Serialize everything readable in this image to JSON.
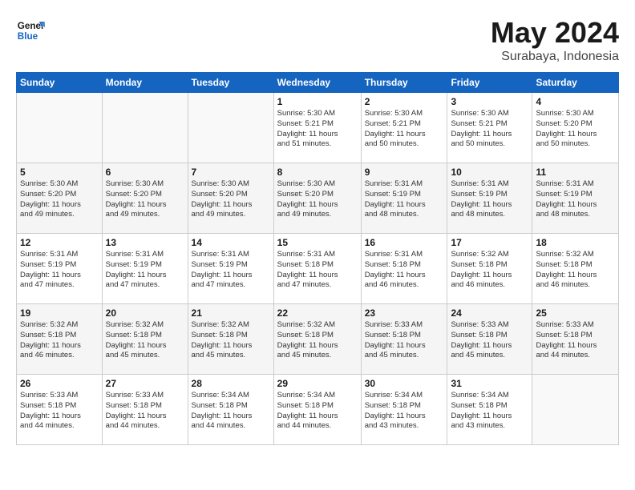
{
  "logo": {
    "line1": "General",
    "line2": "Blue"
  },
  "title": "May 2024",
  "subtitle": "Surabaya, Indonesia",
  "days_header": [
    "Sunday",
    "Monday",
    "Tuesday",
    "Wednesday",
    "Thursday",
    "Friday",
    "Saturday"
  ],
  "weeks": [
    [
      {
        "day": "",
        "info": ""
      },
      {
        "day": "",
        "info": ""
      },
      {
        "day": "",
        "info": ""
      },
      {
        "day": "1",
        "info": "Sunrise: 5:30 AM\nSunset: 5:21 PM\nDaylight: 11 hours\nand 51 minutes."
      },
      {
        "day": "2",
        "info": "Sunrise: 5:30 AM\nSunset: 5:21 PM\nDaylight: 11 hours\nand 50 minutes."
      },
      {
        "day": "3",
        "info": "Sunrise: 5:30 AM\nSunset: 5:21 PM\nDaylight: 11 hours\nand 50 minutes."
      },
      {
        "day": "4",
        "info": "Sunrise: 5:30 AM\nSunset: 5:20 PM\nDaylight: 11 hours\nand 50 minutes."
      }
    ],
    [
      {
        "day": "5",
        "info": "Sunrise: 5:30 AM\nSunset: 5:20 PM\nDaylight: 11 hours\nand 49 minutes."
      },
      {
        "day": "6",
        "info": "Sunrise: 5:30 AM\nSunset: 5:20 PM\nDaylight: 11 hours\nand 49 minutes."
      },
      {
        "day": "7",
        "info": "Sunrise: 5:30 AM\nSunset: 5:20 PM\nDaylight: 11 hours\nand 49 minutes."
      },
      {
        "day": "8",
        "info": "Sunrise: 5:30 AM\nSunset: 5:20 PM\nDaylight: 11 hours\nand 49 minutes."
      },
      {
        "day": "9",
        "info": "Sunrise: 5:31 AM\nSunset: 5:19 PM\nDaylight: 11 hours\nand 48 minutes."
      },
      {
        "day": "10",
        "info": "Sunrise: 5:31 AM\nSunset: 5:19 PM\nDaylight: 11 hours\nand 48 minutes."
      },
      {
        "day": "11",
        "info": "Sunrise: 5:31 AM\nSunset: 5:19 PM\nDaylight: 11 hours\nand 48 minutes."
      }
    ],
    [
      {
        "day": "12",
        "info": "Sunrise: 5:31 AM\nSunset: 5:19 PM\nDaylight: 11 hours\nand 47 minutes."
      },
      {
        "day": "13",
        "info": "Sunrise: 5:31 AM\nSunset: 5:19 PM\nDaylight: 11 hours\nand 47 minutes."
      },
      {
        "day": "14",
        "info": "Sunrise: 5:31 AM\nSunset: 5:19 PM\nDaylight: 11 hours\nand 47 minutes."
      },
      {
        "day": "15",
        "info": "Sunrise: 5:31 AM\nSunset: 5:18 PM\nDaylight: 11 hours\nand 47 minutes."
      },
      {
        "day": "16",
        "info": "Sunrise: 5:31 AM\nSunset: 5:18 PM\nDaylight: 11 hours\nand 46 minutes."
      },
      {
        "day": "17",
        "info": "Sunrise: 5:32 AM\nSunset: 5:18 PM\nDaylight: 11 hours\nand 46 minutes."
      },
      {
        "day": "18",
        "info": "Sunrise: 5:32 AM\nSunset: 5:18 PM\nDaylight: 11 hours\nand 46 minutes."
      }
    ],
    [
      {
        "day": "19",
        "info": "Sunrise: 5:32 AM\nSunset: 5:18 PM\nDaylight: 11 hours\nand 46 minutes."
      },
      {
        "day": "20",
        "info": "Sunrise: 5:32 AM\nSunset: 5:18 PM\nDaylight: 11 hours\nand 45 minutes."
      },
      {
        "day": "21",
        "info": "Sunrise: 5:32 AM\nSunset: 5:18 PM\nDaylight: 11 hours\nand 45 minutes."
      },
      {
        "day": "22",
        "info": "Sunrise: 5:32 AM\nSunset: 5:18 PM\nDaylight: 11 hours\nand 45 minutes."
      },
      {
        "day": "23",
        "info": "Sunrise: 5:33 AM\nSunset: 5:18 PM\nDaylight: 11 hours\nand 45 minutes."
      },
      {
        "day": "24",
        "info": "Sunrise: 5:33 AM\nSunset: 5:18 PM\nDaylight: 11 hours\nand 45 minutes."
      },
      {
        "day": "25",
        "info": "Sunrise: 5:33 AM\nSunset: 5:18 PM\nDaylight: 11 hours\nand 44 minutes."
      }
    ],
    [
      {
        "day": "26",
        "info": "Sunrise: 5:33 AM\nSunset: 5:18 PM\nDaylight: 11 hours\nand 44 minutes."
      },
      {
        "day": "27",
        "info": "Sunrise: 5:33 AM\nSunset: 5:18 PM\nDaylight: 11 hours\nand 44 minutes."
      },
      {
        "day": "28",
        "info": "Sunrise: 5:34 AM\nSunset: 5:18 PM\nDaylight: 11 hours\nand 44 minutes."
      },
      {
        "day": "29",
        "info": "Sunrise: 5:34 AM\nSunset: 5:18 PM\nDaylight: 11 hours\nand 44 minutes."
      },
      {
        "day": "30",
        "info": "Sunrise: 5:34 AM\nSunset: 5:18 PM\nDaylight: 11 hours\nand 43 minutes."
      },
      {
        "day": "31",
        "info": "Sunrise: 5:34 AM\nSunset: 5:18 PM\nDaylight: 11 hours\nand 43 minutes."
      },
      {
        "day": "",
        "info": ""
      }
    ]
  ]
}
